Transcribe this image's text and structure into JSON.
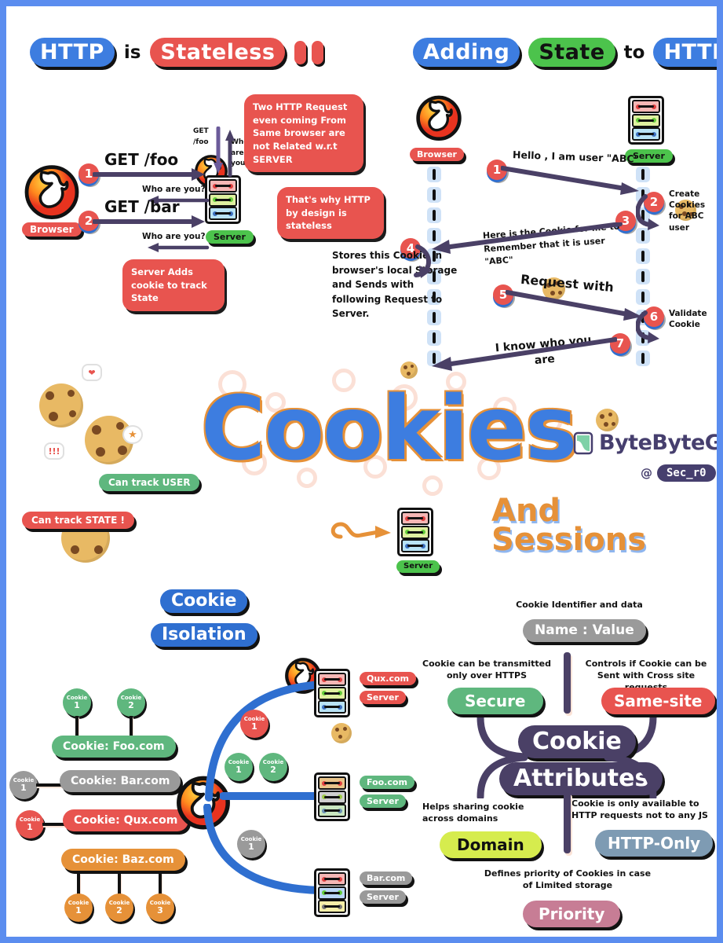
{
  "meta": {
    "border_color": "#5b8def",
    "page_background": "#ffffff"
  },
  "brand": {
    "name": "ByteByteGo",
    "at": "@",
    "handle": "Sec_r0"
  },
  "header_left": {
    "http_label": "HTTP",
    "is_label": "is",
    "stateless_label": "Stateless",
    "exclaim": "!!"
  },
  "header_right": {
    "adding_label": "Adding",
    "state_label": "State",
    "to_label": "to",
    "http_label": "HTTP",
    "exclaim": "!"
  },
  "stateless_diagram": {
    "browser_label": "Browser",
    "server_label": "Server",
    "step1_number": "1",
    "step1_request": "GET /foo",
    "step1_response": "Who are you?",
    "step2_number": "2",
    "step2_request": "GET /bar",
    "step2_response": "Who are you?",
    "top_get_label": "GET\n/foo",
    "top_who_label": "Who\nare\nyou ?",
    "bubble_top": "Two HTTP Request even coming From Same browser are not Related w.r.t SERVER",
    "bubble_mid": "That's why HTTP by design is stateless",
    "bubble_bottom": "Server Adds cookie to track State"
  },
  "state_diagram": {
    "browser_label": "Browser",
    "server_label": "Server",
    "steps": [
      {
        "n": "1",
        "text": "Hello , I am user \"ABC\""
      },
      {
        "n": "2",
        "text": "Create Cookies for ABC user"
      },
      {
        "n": "3",
        "text": "Here is the Cookie for me to Remember that it is user \"ABC\""
      },
      {
        "n": "4",
        "text": "Stores this Cookie in browser's local Storage and Sends with following Request to Server."
      },
      {
        "n": "5",
        "text": "Request with"
      },
      {
        "n": "6",
        "text": "Validate Cookie"
      },
      {
        "n": "7",
        "text": "I know who you are"
      }
    ]
  },
  "center": {
    "title": "Cookies",
    "subtitle_line1": "And",
    "subtitle_line2": "Sessions",
    "server_label": "Server",
    "can_track_user": "Can track USER",
    "can_track_state": "Can track STATE !"
  },
  "cookie_isolation": {
    "title_line1": "Cookie",
    "title_line2": "Isolation",
    "domains": [
      {
        "label": "Cookie: Foo.com",
        "color": "#5fb77e",
        "cookies": [
          {
            "t": "Cookie",
            "n": "1"
          },
          {
            "t": "Cookie",
            "n": "2"
          }
        ],
        "cookies_position": "top"
      },
      {
        "label": "Cookie: Bar.com",
        "color": "#9a9a9a",
        "cookies": [
          {
            "t": "Cookie",
            "n": "1"
          }
        ],
        "cookies_position": "left"
      },
      {
        "label": "Cookie: Qux.com",
        "color": "#e8544f",
        "cookies": [
          {
            "t": "Cookie",
            "n": "1"
          }
        ],
        "cookies_position": "left"
      },
      {
        "label": "Cookie: Baz.com",
        "color": "#e69138",
        "cookies": [
          {
            "t": "Cookie",
            "n": "1"
          },
          {
            "t": "Cookie",
            "n": "2"
          },
          {
            "t": "Cookie",
            "n": "3"
          }
        ],
        "cookies_position": "bottom"
      }
    ],
    "flows": [
      {
        "cookie": {
          "t": "Cookie",
          "n": "1"
        },
        "cookie_color": "#e8544f",
        "server_domain": "Qux.com",
        "server_label": "Server",
        "tag_color": "#e8544f"
      },
      {
        "cookie": {
          "t": "Cookie",
          "n": "1"
        },
        "cookie2": {
          "t": "Cookie",
          "n": "2"
        },
        "cookie_color": "#5fb77e",
        "server_domain": "Foo.com",
        "server_label": "Server",
        "tag_color": "#5fb77e"
      },
      {
        "cookie": {
          "t": "Cookie",
          "n": "1"
        },
        "cookie_color": "#9a9a9a",
        "server_domain": "Bar.com",
        "server_label": "Server",
        "tag_color": "#9a9a9a"
      }
    ]
  },
  "cookie_attributes": {
    "center_line1": "Cookie",
    "center_line2": "Attributes",
    "items": [
      {
        "note": "Cookie Identifier and data",
        "label": "Name : Value",
        "color": "#9a9a9a",
        "position": "top"
      },
      {
        "note": "Cookie can be transmitted only over HTTPS",
        "label": "Secure",
        "color": "#5fb77e",
        "position": "top-left"
      },
      {
        "note": "Controls if Cookie can be Sent with Cross site requests",
        "label": "Same-site",
        "color": "#e8544f",
        "position": "top-right"
      },
      {
        "note": "Helps sharing cookie across domains",
        "label": "Domain",
        "color": "#d6ec4e",
        "position": "bottom-left"
      },
      {
        "note": "Cookie is only available to HTTP requests not to any JS",
        "label": "HTTP-Only",
        "color": "#7e9bb3",
        "position": "bottom-right"
      },
      {
        "note": "Defines priority of Cookies in case of Limited storage",
        "label": "Priority",
        "color": "#c77d95",
        "position": "bottom"
      }
    ]
  }
}
